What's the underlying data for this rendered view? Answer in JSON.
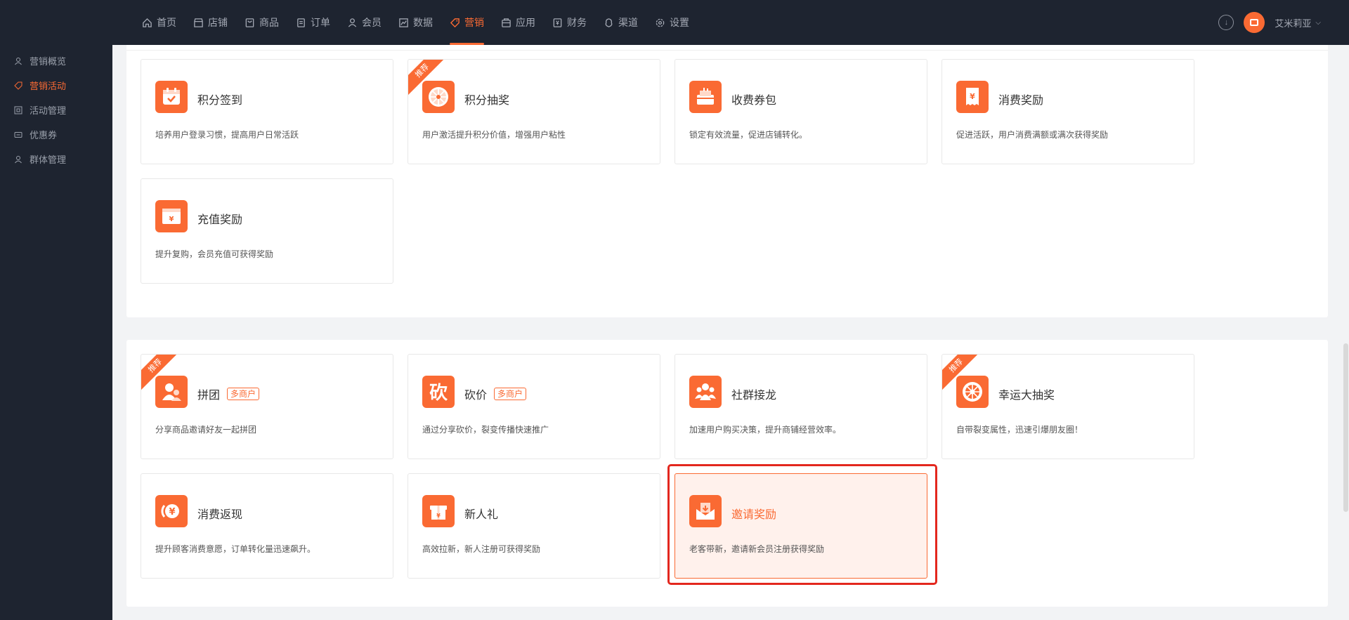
{
  "nav": {
    "items": [
      {
        "label": "首页",
        "icon": "home-icon"
      },
      {
        "label": "店铺",
        "icon": "store-icon"
      },
      {
        "label": "商品",
        "icon": "goods-icon"
      },
      {
        "label": "订单",
        "icon": "order-icon"
      },
      {
        "label": "会员",
        "icon": "member-icon"
      },
      {
        "label": "数据",
        "icon": "chart-icon"
      },
      {
        "label": "营销",
        "icon": "tag-icon",
        "active": true
      },
      {
        "label": "应用",
        "icon": "app-icon"
      },
      {
        "label": "财务",
        "icon": "finance-icon"
      },
      {
        "label": "渠道",
        "icon": "channel-icon"
      },
      {
        "label": "设置",
        "icon": "gear-icon"
      }
    ],
    "username": "艾米莉亚"
  },
  "sidebar": {
    "items": [
      {
        "label": "营销概览"
      },
      {
        "label": "营销活动",
        "active": true
      },
      {
        "label": "活动管理"
      },
      {
        "label": "优惠券"
      },
      {
        "label": "群体管理"
      }
    ]
  },
  "colors": {
    "accent": "#fa6a33",
    "highlight": "#e3271e",
    "sidebar_bg": "#1e2430"
  },
  "section1": {
    "cards": [
      {
        "title": "积分签到",
        "desc": "培养用户登录习惯，提高用户日常活跃",
        "icon": "calendar-check-icon"
      },
      {
        "title": "积分抽奖",
        "desc": "用户激活提升积分价值，增强用户粘性",
        "icon": "wheel-icon",
        "ribbon": "推荐"
      },
      {
        "title": "收费券包",
        "desc": "锁定有效流量，促进店铺转化。",
        "icon": "coupon-pack-icon"
      },
      {
        "title": "消费奖励",
        "desc": "促进活跃，用户消费满额或满次获得奖励",
        "icon": "receipt-yen-icon"
      },
      {
        "title": "充值奖励",
        "desc": "提升复购，会员充值可获得奖励",
        "icon": "recharge-yen-icon"
      }
    ]
  },
  "section2": {
    "cards": [
      {
        "title": "拼团",
        "tag": "多商户",
        "desc": "分享商品邀请好友一起拼团",
        "icon": "group-buy-icon",
        "ribbon": "推荐"
      },
      {
        "title": "砍价",
        "tag": "多商户",
        "desc": "通过分享砍价，裂变传播快速推广",
        "icon": "bargain-icon"
      },
      {
        "title": "社群接龙",
        "desc": "加速用户购买决策，提升商铺经营效率。",
        "icon": "community-icon"
      },
      {
        "title": "幸运大抽奖",
        "desc": "自带裂变属性，迅速引爆朋友圈！",
        "icon": "lucky-wheel-icon",
        "ribbon": "推荐"
      },
      {
        "title": "消费返现",
        "desc": "提升顾客消费意愿，订单转化量迅速飙升。",
        "icon": "cashback-icon"
      },
      {
        "title": "新人礼",
        "desc": "高效拉新，新人注册可获得奖励",
        "icon": "gift-icon"
      },
      {
        "title": "邀请奖励",
        "desc": "老客带新，邀请新会员注册获得奖励",
        "icon": "invite-envelope-icon",
        "selected": true
      }
    ]
  }
}
